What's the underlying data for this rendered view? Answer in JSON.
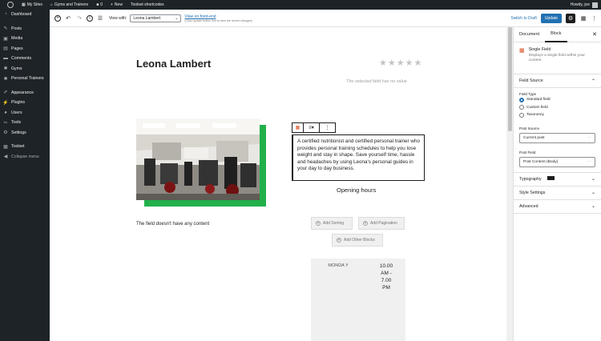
{
  "admin_bar": {
    "my_sites": "My Sites",
    "site_name": "Gyms and Trainers",
    "comments_count": "0",
    "new_label": "New",
    "toolset_shortcodes": "Toolset shortcodes",
    "howdy": "Howdy, joe"
  },
  "menu": {
    "items": [
      {
        "label": "Dashboard",
        "icon": "dashboard-icon"
      },
      {
        "label": "Posts",
        "icon": "pin-icon"
      },
      {
        "label": "Media",
        "icon": "media-icon"
      },
      {
        "label": "Pages",
        "icon": "pages-icon"
      },
      {
        "label": "Comments",
        "icon": "comment-icon"
      },
      {
        "label": "Gyms",
        "icon": "gym-icon"
      },
      {
        "label": "Personal Trainers",
        "icon": "trainer-icon"
      },
      {
        "label": "Appearance",
        "icon": "brush-icon"
      },
      {
        "label": "Plugins",
        "icon": "plugin-icon"
      },
      {
        "label": "Users",
        "icon": "users-icon"
      },
      {
        "label": "Tools",
        "icon": "tools-icon"
      },
      {
        "label": "Settings",
        "icon": "settings-icon"
      },
      {
        "label": "Toolset",
        "icon": "toolset-icon"
      }
    ],
    "collapse": "Collapse menu"
  },
  "toolbar": {
    "view_with_label": "View with:",
    "view_select_value": "Leona Lambert",
    "view_frontend_link": "View on front-end",
    "view_frontend_note": "(Click Update button first to view the recent changes)",
    "switch_to_draft": "Switch to Draft",
    "update": "Update"
  },
  "content": {
    "title": "Leona Lambert",
    "rating": 0,
    "rating_max": 5,
    "empty_field_note": "The selected field has no value",
    "bio": "A certified nutritionist and certified personal trainer who provides personal training schedules to help you lose weight and stay in shape. Save yourself time, hassle and headaches by using Leona's personal guides in your day to day business.",
    "opening_hours_heading": "Opening hours",
    "field_no_content": "The field doesn't have any content",
    "add_sorting": "Add Sorting",
    "add_pagination": "Add Pagination",
    "add_other_blocks": "Add Other Blocks",
    "hours_day": "MONDA Y",
    "hours_time": "10.00 AM - 7.00 PM"
  },
  "sidebar": {
    "tab_document": "Document",
    "tab_block": "Block",
    "block_name": "Single Field",
    "block_desc": "Displays a single field within your content.",
    "field_source": "Field Source",
    "field_type_label": "Field Type",
    "field_types": [
      "Standard field",
      "Custom field",
      "Taxonomy"
    ],
    "selected_field_type": 0,
    "post_source_label": "Post Source",
    "post_source_value": "Current post",
    "post_field_label": "Post Field",
    "post_field_value": "Post Content (Body)",
    "typography": "Typography",
    "style_settings": "Style Settings",
    "advanced": "Advanced"
  },
  "colors": {
    "admin_dark": "#1d2327",
    "accent_blue": "#2271b1",
    "green_accent": "#22b04b",
    "block_icon_orange": "#d54e21"
  }
}
